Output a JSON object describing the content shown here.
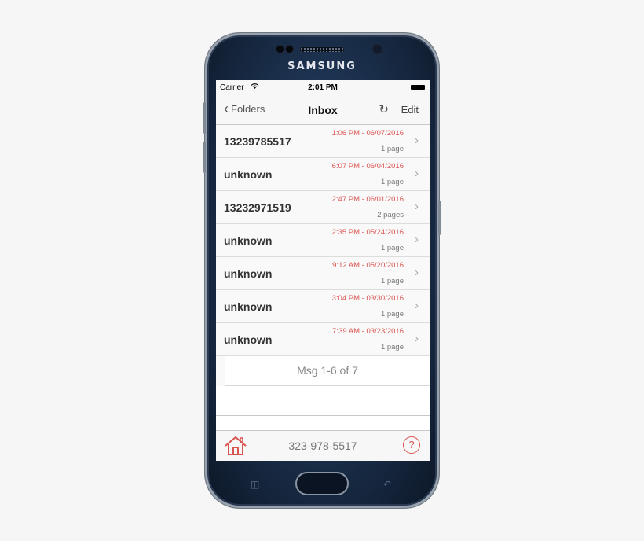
{
  "device": {
    "brand": "SAMSUNG"
  },
  "status_bar": {
    "carrier": "Carrier",
    "time": "2:01 PM"
  },
  "nav": {
    "back_label": "Folders",
    "title": "Inbox",
    "edit_label": "Edit"
  },
  "messages": [
    {
      "sender": "13239785517",
      "datetime": "1:06 PM - 06/07/2016",
      "pages": "1 page"
    },
    {
      "sender": "unknown",
      "datetime": "6:07 PM - 06/04/2016",
      "pages": "1 page"
    },
    {
      "sender": "13232971519",
      "datetime": "2:47 PM - 06/01/2016",
      "pages": "2 pages"
    },
    {
      "sender": "unknown",
      "datetime": "2:35 PM - 05/24/2016",
      "pages": "1 page"
    },
    {
      "sender": "unknown",
      "datetime": "9:12 AM - 05/20/2016",
      "pages": "1 page"
    },
    {
      "sender": "unknown",
      "datetime": "3:04 PM - 03/30/2016",
      "pages": "1 page"
    },
    {
      "sender": "unknown",
      "datetime": "7:39 AM - 03/23/2016",
      "pages": "1 page"
    }
  ],
  "summary": "Msg 1-6 of 7",
  "footer": {
    "phone_number": "323-978-5517",
    "help_label": "?"
  },
  "icons": {
    "back": "chevron-left-icon",
    "refresh": "refresh-icon",
    "row_arrow": "chevron-right-icon",
    "home": "home-icon",
    "help": "question-circle-icon"
  },
  "colors": {
    "accent": "#d9534f",
    "text": "#333333",
    "muted": "#888888"
  }
}
